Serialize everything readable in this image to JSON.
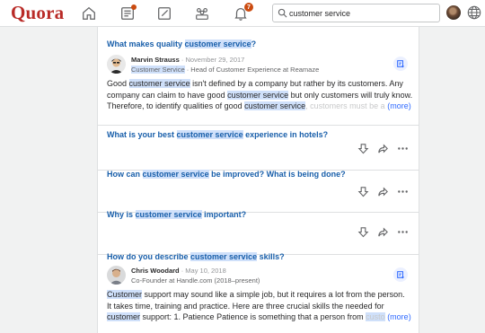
{
  "header": {
    "logo": "Quora",
    "nav": [
      {
        "name": "home-icon"
      },
      {
        "name": "answer-icon"
      },
      {
        "name": "write-icon"
      },
      {
        "name": "spaces-icon"
      },
      {
        "name": "notifications-icon",
        "badge": "7"
      }
    ],
    "search": {
      "value": "customer service",
      "placeholder": "Search Quora"
    }
  },
  "colors": {
    "brand": "#b92b27",
    "link": "#195faa",
    "highlight": "#cfe0fa",
    "badge": "#cb4b10"
  },
  "feed": [
    {
      "title_parts": [
        "What makes quality ",
        "customer",
        " ",
        "service",
        "?"
      ],
      "author": "Marvin Strauss",
      "date": "· November 29, 2017",
      "cred_parts": [
        "Customer",
        " ",
        "Service",
        " · Head of Customer Experience at Reamaze"
      ],
      "lines": [
        [
          "Good ",
          "customer",
          " ",
          "service",
          " isn't defined by a company but rather by its customers. Any"
        ],
        [
          "company can claim to have good ",
          "customer",
          " ",
          "service",
          " but only customers will truly know."
        ],
        [
          "Therefore, to identify qualities of good ",
          "customer",
          " ",
          "service",
          ", customers must be a"
        ]
      ],
      "more": "(more)"
    },
    {
      "title_parts": [
        "What is your best ",
        "customer",
        " ",
        "service",
        " experience in hotels?"
      ]
    },
    {
      "title_parts": [
        "How can ",
        "customer",
        " ",
        "service",
        " be improved? What is being done?"
      ]
    },
    {
      "title_parts": [
        "Why is ",
        "customer",
        " ",
        "service",
        " important?"
      ]
    },
    {
      "title_parts": [
        "How do you describe ",
        "customer",
        " ",
        "service",
        " skills?"
      ],
      "author": "Chris Woodard",
      "date": "· May 10, 2018",
      "cred_parts": [
        "Co-Founder at Handle.com (2018–present)"
      ],
      "lines": [
        [
          "Customer",
          " support may sound like a simple job, but it requires a lot from the person."
        ],
        [
          "It takes time, training and practice. Here are three crucial skills the needed for"
        ],
        [
          "customer",
          " support: 1. Patience Patience is something that a person from ",
          "custo"
        ]
      ],
      "more": "(more)"
    }
  ]
}
